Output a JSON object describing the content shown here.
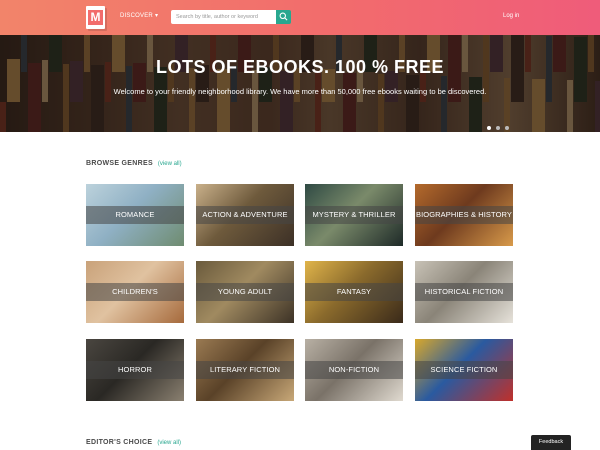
{
  "header": {
    "logo_letter": "M",
    "discover_label": "DISCOVER",
    "search_placeholder": "Search by title, author or keyword",
    "login_label": "Log in"
  },
  "hero": {
    "title": "LOTS OF EBOOKS. 100 % FREE",
    "subtitle": "Welcome to your friendly neighborhood library. We have more than 50,000 free ebooks waiting to be discovered.",
    "slides": 3,
    "active_slide": 1
  },
  "browse_genres": {
    "title": "BROWSE GENRES",
    "view_all": "(view all)",
    "genres": [
      {
        "label": "ROMANCE",
        "colors": [
          "#bcd2dc",
          "#8fb0c4",
          "#6f8c70"
        ]
      },
      {
        "label": "ACTION & ADVENTURE",
        "colors": [
          "#c9b08a",
          "#6e5a3c",
          "#3c3026"
        ]
      },
      {
        "label": "MYSTERY & THRILLER",
        "colors": [
          "#2f4a44",
          "#7a8a6a",
          "#1e2a28"
        ]
      },
      {
        "label": "BIOGRAPHIES & HISTORY",
        "colors": [
          "#b46a2c",
          "#6e3a1e",
          "#d89a4a"
        ]
      },
      {
        "label": "CHILDREN'S",
        "colors": [
          "#c9a27a",
          "#e0c2a0",
          "#a66a3c"
        ]
      },
      {
        "label": "YOUNG ADULT",
        "colors": [
          "#6a5a3c",
          "#a08a60",
          "#3c3226"
        ]
      },
      {
        "label": "FANTASY",
        "colors": [
          "#e0b44a",
          "#8a6a2c",
          "#3a2a1a"
        ]
      },
      {
        "label": "HISTORICAL FICTION",
        "colors": [
          "#c8c2b6",
          "#8a8478",
          "#e6e2da"
        ]
      },
      {
        "label": "HORROR",
        "colors": [
          "#4a4640",
          "#2a2824",
          "#8a8070"
        ]
      },
      {
        "label": "LITERARY FICTION",
        "colors": [
          "#9a7a52",
          "#5a4228",
          "#c8a878"
        ]
      },
      {
        "label": "NON-FICTION",
        "colors": [
          "#b8b0a4",
          "#7a7268",
          "#e0dad0"
        ]
      },
      {
        "label": "SCIENCE FICTION",
        "colors": [
          "#d8a82c",
          "#2a5aa0",
          "#c0302a"
        ]
      }
    ]
  },
  "editors_choice": {
    "title": "EDITOR'S CHOICE",
    "view_all": "(view all)"
  },
  "feedback_label": "Feedback",
  "colors": {
    "accent": "#28a78f",
    "header_start": "#f2846a",
    "header_end": "#ef5c7a"
  }
}
